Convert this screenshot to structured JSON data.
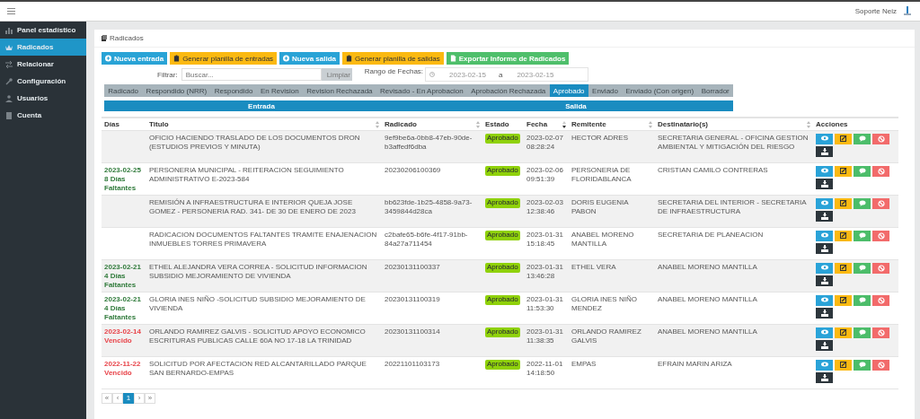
{
  "topbar": {
    "user": "Soporte Neiz"
  },
  "sidebar": {
    "items": [
      {
        "label": "Panel estadístico",
        "selected": false
      },
      {
        "label": "Radicados",
        "selected": true
      },
      {
        "label": "Relacionar",
        "selected": false
      },
      {
        "label": "Configuración",
        "selected": false
      },
      {
        "label": "Usuarios",
        "selected": false
      },
      {
        "label": "Cuenta",
        "selected": false
      }
    ]
  },
  "breadcrumb": "Radicados",
  "actions": [
    {
      "label": "Nueva entrada",
      "kind": "new"
    },
    {
      "label": "Generar planilla de entradas",
      "kind": "sheet"
    },
    {
      "label": "Nueva salida",
      "kind": "new"
    },
    {
      "label": "Generar planilla de salidas",
      "kind": "sheet"
    },
    {
      "label": "Exportar Informe de Radicados",
      "kind": "export"
    }
  ],
  "filter": {
    "label": "Filtrar:",
    "placeholder": "Buscar...",
    "clear": "Limpiar",
    "range_label": "Rango de Fechas:",
    "date_from": "2023-02-15",
    "separator": "a",
    "date_to": "2023-02-15"
  },
  "status_tabs": [
    {
      "label": "Radicado",
      "selected": false
    },
    {
      "label": "Respondido (NRR)",
      "selected": false
    },
    {
      "label": "Respondido",
      "selected": false
    },
    {
      "label": "En Revision",
      "selected": false
    },
    {
      "label": "Revision Rechazada",
      "selected": false
    },
    {
      "label": "Revisado - En Aprobacion",
      "selected": false
    },
    {
      "label": "Aprobación Rechazada",
      "selected": false
    },
    {
      "label": "Aprobado",
      "selected": true
    },
    {
      "label": "Enviado",
      "selected": false
    },
    {
      "label": "Enviado (Con origen)",
      "selected": false
    },
    {
      "label": "Borrador",
      "selected": false
    }
  ],
  "direction_tabs": [
    "Entrada",
    "Salida"
  ],
  "table": {
    "columns": [
      {
        "label": "Días",
        "kind": "plain"
      },
      {
        "label": "Titulo",
        "kind": "sortable"
      },
      {
        "label": "Radicado",
        "kind": "sortable"
      },
      {
        "label": "Estado",
        "kind": "plain"
      },
      {
        "label": "Fecha",
        "kind": "descending"
      },
      {
        "label": "Remitente",
        "kind": "sortable"
      },
      {
        "label": "Destinatario(s)",
        "kind": "sortable"
      },
      {
        "label": "Acciones",
        "kind": "plain"
      }
    ],
    "rows": [
      {
        "days": [],
        "kind": "plain",
        "title": "OFICIO HACIENDO TRASLADO DE LOS DOCUMENTOS DRON (ESTUDIOS PREVIOS Y MINUTA)",
        "radicado": "9ef9be6a-0bb8-47eb-90de-b3affedf6dba",
        "status": "Aprobado",
        "date": "2023-02-07",
        "time": "08:28:24",
        "sender": "HECTOR ADRES",
        "recipient": "SECRETARIA GENERAL - OFICINA GESTION AMBIENTAL Y MITIGACIÓN DEL RIESGO"
      },
      {
        "days": [
          "2023-02-25",
          "8 Días Faltantes"
        ],
        "kind": "pending",
        "title": "PERSONERIA MUNICIPAL - REITERACION SEGUIMIENTO ADMINISTRATIVO E-2023-584",
        "radicado": "20230206100369",
        "status": "Aprobado",
        "date": "2023-02-06",
        "time": "09:51:39",
        "sender": "PERSONERIA DE FLORIDABLANCA",
        "recipient": "CRISTIAN CAMILO CONTRERAS"
      },
      {
        "days": [],
        "kind": "plain",
        "title": "REMISIÓN A INFRAESTRUCTURA E INTERIOR QUEJA JOSE GOMEZ - PERSONERIA RAD. 341- DE 30 DE ENERO DE 2023",
        "radicado": "bb623fde-1b25-4858-9a73-3459844d28ca",
        "status": "Aprobado",
        "date": "2023-02-03",
        "time": "12:38:46",
        "sender": "DORIS EUGENIA PABON",
        "recipient": "SECRETARIA DEL INTERIOR - SECRETARIA DE INFRAESTRUCTURA"
      },
      {
        "days": [],
        "kind": "plain",
        "title": "RADICACION DOCUMENTOS FALTANTES TRAMITE ENAJENACION INMUEBLES TORRES PRIMAVERA",
        "radicado": "c2bafe65-b6fe-4f17-91bb-84a27a711454",
        "status": "Aprobado",
        "date": "2023-01-31",
        "time": "15:18:45",
        "sender": "ANABEL MORENO MANTILLA",
        "recipient": "SECRETARIA DE PLANEACION"
      },
      {
        "days": [
          "2023-02-21",
          "4 Días Faltantes"
        ],
        "kind": "pending",
        "title": "ETHEL ALEJANDRA VERA CORREA - SOLICITUD INFORMACION SUBSIDIO MEJORAMIENTO DE VIVIENDA",
        "radicado": "20230131100337",
        "status": "Aprobado",
        "date": "2023-01-31",
        "time": "13:46:28",
        "sender": "ETHEL VERA",
        "recipient": "ANABEL MORENO MANTILLA"
      },
      {
        "days": [
          "2023-02-21",
          "4 Días Faltantes"
        ],
        "kind": "pending",
        "title": "GLORIA INES NIÑO -SOLICITUD SUBSIDIO MEJORAMIENTO DE VIVIENDA",
        "radicado": "20230131100319",
        "status": "Aprobado",
        "date": "2023-01-31",
        "time": "11:53:30",
        "sender": "GLORIA INES NIÑO MENDEZ",
        "recipient": "ANABEL MORENO MANTILLA"
      },
      {
        "days": [
          "2023-02-14",
          "Vencido"
        ],
        "kind": "overdue",
        "title": "ORLANDO RAMIREZ GALVIS - SOLICITUD APOYO ECONOMICO ESCRITURAS PUBLICAS CALLE 60A NO 17-18 LA TRINIDAD",
        "radicado": "20230131100314",
        "status": "Aprobado",
        "date": "2023-01-31",
        "time": "11:38:35",
        "sender": "ORLANDO RAMIREZ GALVIS",
        "recipient": "ANABEL MORENO MANTILLA"
      },
      {
        "days": [
          "2022-11-22",
          "Vencido"
        ],
        "kind": "overdue",
        "title": "SOLICITUD POR AFECTACION RED ALCANTARILLADO PARQUE SAN BERNARDO-EMPAS",
        "radicado": "20221101103173",
        "status": "Aprobado",
        "date": "2022-11-01",
        "time": "14:18:50",
        "sender": "EMPAS",
        "recipient": "EFRAIN MARIN ARIZA"
      }
    ]
  },
  "pagination": [
    {
      "label": "«",
      "selected": false
    },
    {
      "label": "‹",
      "selected": false
    },
    {
      "label": "1",
      "selected": true
    },
    {
      "label": "›",
      "selected": false
    },
    {
      "label": "»",
      "selected": false
    }
  ]
}
